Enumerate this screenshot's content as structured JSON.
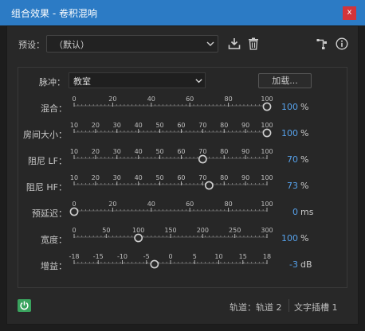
{
  "window": {
    "title": "组合效果 - 卷积混响",
    "close_label": "x"
  },
  "preset": {
    "label": "预设：",
    "value": "（默认）"
  },
  "pulse": {
    "label": "脉冲：",
    "value": "教室",
    "load_label": "加载..."
  },
  "sliders": [
    {
      "id": "mix",
      "label": "混合：",
      "ticks": [
        "0",
        "20",
        "40",
        "60",
        "80",
        "100"
      ],
      "value_text": "100",
      "unit": "%",
      "knob_fraction": 1.0
    },
    {
      "id": "room-size",
      "label": "房间大小：",
      "ticks": [
        "10",
        "20",
        "30",
        "40",
        "50",
        "60",
        "70",
        "80",
        "90",
        "100"
      ],
      "value_text": "100",
      "unit": "%",
      "knob_fraction": 1.0
    },
    {
      "id": "damp-lf",
      "label": "阻尼 LF：",
      "ticks": [
        "10",
        "20",
        "30",
        "40",
        "50",
        "60",
        "70",
        "80",
        "90",
        "100"
      ],
      "value_text": "70",
      "unit": "%",
      "knob_fraction": 0.6667
    },
    {
      "id": "damp-hf",
      "label": "阻尼 HF：",
      "ticks": [
        "10",
        "20",
        "30",
        "40",
        "50",
        "60",
        "70",
        "80",
        "90",
        "100"
      ],
      "value_text": "73",
      "unit": "%",
      "knob_fraction": 0.7
    },
    {
      "id": "predelay",
      "label": "预延迟：",
      "ticks": [
        "0",
        "20",
        "40",
        "60",
        "80",
        "100"
      ],
      "value_text": "0",
      "unit": "ms",
      "knob_fraction": 0.0
    },
    {
      "id": "width",
      "label": "宽度：",
      "ticks": [
        "0",
        "50",
        "100",
        "150",
        "200",
        "250",
        "300"
      ],
      "value_text": "100",
      "unit": "%",
      "knob_fraction": 0.3333
    },
    {
      "id": "gain",
      "label": "增益：",
      "ticks": [
        "-18",
        "-15",
        "-10",
        "-5",
        "0",
        "5",
        "10",
        "15",
        "18"
      ],
      "value_text": "-3",
      "unit": "dB",
      "knob_fraction": 0.4167
    }
  ],
  "footer": {
    "track_text": "轨道：轨道 2",
    "insert_text": "文字插槽 1"
  },
  "icons": {
    "chevron": "chevron-down-icon",
    "save": "download-icon",
    "delete": "trash-icon",
    "routing": "routing-icon",
    "info": "info-icon",
    "power": "power-icon"
  },
  "colors": {
    "accent": "#2c7bc5",
    "value": "#56a1ea",
    "power": "#3aa35e",
    "close": "#d2343a"
  }
}
